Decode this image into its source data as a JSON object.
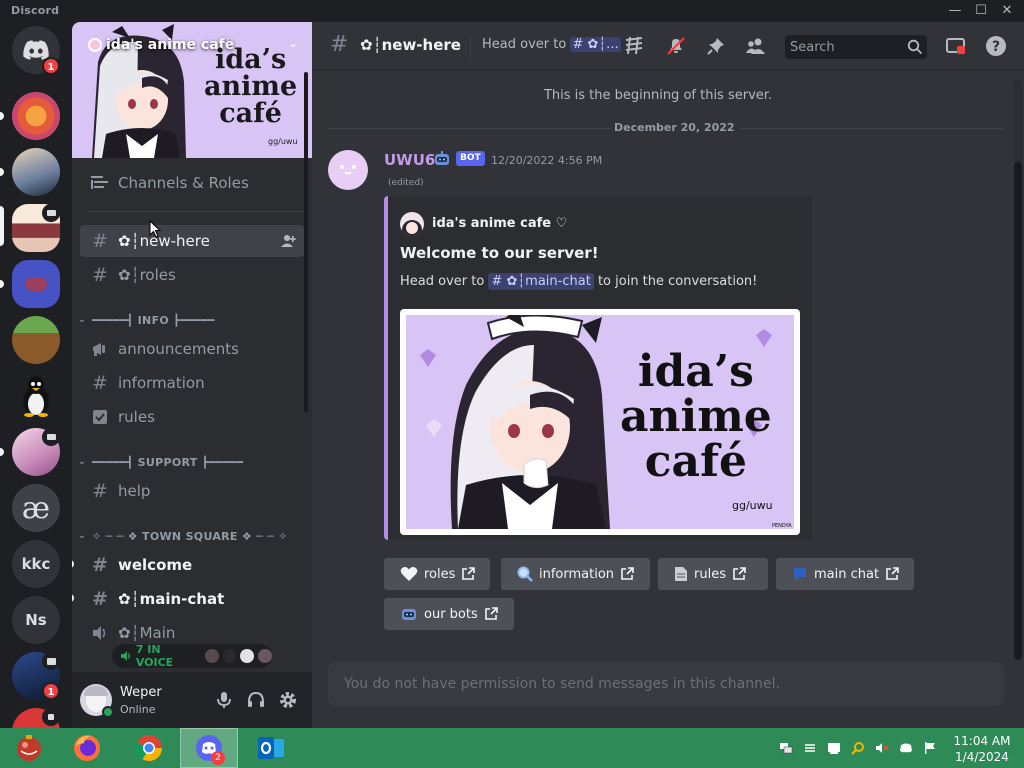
{
  "window": {
    "app_title": "Discord",
    "minimize": "—",
    "maximize": "☐",
    "close": "✕"
  },
  "rail": {
    "home_badge": "1",
    "bottom_badge": "1",
    "servers": [
      {
        "label": "kkc"
      },
      {
        "label": "Ns"
      },
      {
        "label": "æ"
      }
    ]
  },
  "server": {
    "name": "ida's anime cafe",
    "banner_text_1": "ida’s",
    "banner_text_2": "anime",
    "banner_text_3": "café",
    "banner_sig": "gg/uwu",
    "channels_roles": "Channels & Roles",
    "channels": {
      "new_here": "✿┆new-here",
      "roles": "✿┆roles",
      "announcements": "announcements",
      "information": "information",
      "rules": "rules",
      "help": "help",
      "welcome": "welcome",
      "main_chat": "✿┆main-chat",
      "main_voice": "✿┆Main"
    },
    "categories": {
      "info": "━━━━━┫ INFO ┣━━━━━",
      "support": "━━━━━┫ SUPPORT ┣━━━━━",
      "town_square": "✧ ─ ─ ❖ TOWN SQUARE ❖ ─ ─ ✧"
    },
    "voice_count": "7 IN VOICE"
  },
  "user": {
    "name": "Weper",
    "status": "Online"
  },
  "header": {
    "channel": "✿┆new-here",
    "topic_prefix": "Head over to",
    "topic_mention": "# ✿┆...",
    "search_placeholder": "Search"
  },
  "chat": {
    "beginning": "This is the beginning of this server.",
    "date": "December 20, 2022",
    "message": {
      "author": "UWU6",
      "badge": "BOT",
      "time": "12/20/2022 4:56 PM",
      "edited": "(edited)",
      "embed": {
        "author": "ida's anime cafe ♡",
        "title": "Welcome to our server!",
        "desc_before": "Head over to",
        "mention": "# ✿┆main-chat",
        "desc_after": "to join the conversation!",
        "image_text_1": "ida’s",
        "image_text_2": "anime",
        "image_text_3": "café",
        "image_sig": "gg/uwu",
        "image_credit": "PENDYA"
      },
      "buttons": [
        {
          "label": "roles"
        },
        {
          "label": "information"
        },
        {
          "label": "rules"
        },
        {
          "label": "main chat"
        },
        {
          "label": "our bots"
        }
      ]
    },
    "composer_placeholder": "You do not have permission to send messages in this channel."
  },
  "taskbar": {
    "discord_badge": "2",
    "time": "11:04 AM",
    "date": "1/4/2024"
  },
  "colors": {
    "accent": "#5865f2",
    "embed_bar": "#b98ce8",
    "online": "#23a55a",
    "taskbar": "#2e8b57"
  }
}
